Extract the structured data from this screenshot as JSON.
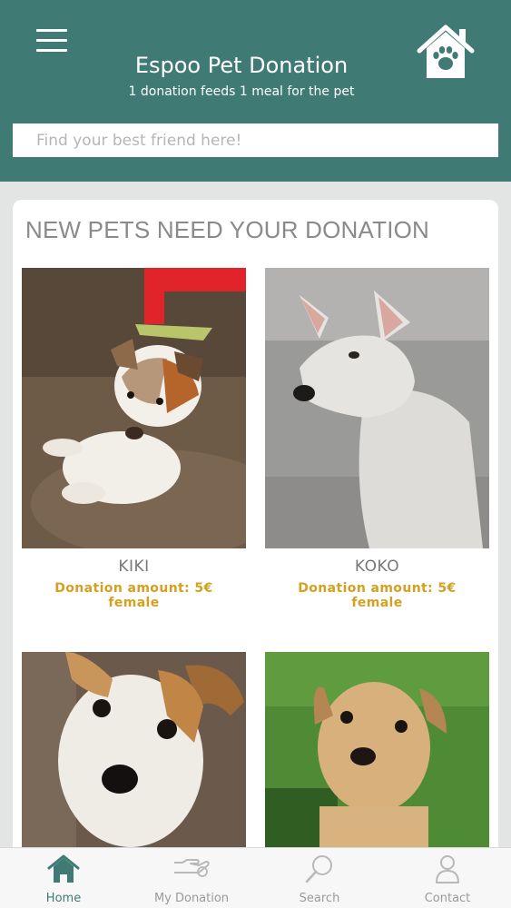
{
  "header": {
    "title": "Espoo Pet Donation",
    "subtitle": "1 donation feeds 1 meal for the pet",
    "menu_icon": "hamburger-menu-icon",
    "logo_icon": "house-paw-icon"
  },
  "search": {
    "placeholder": "Find your best friend here!",
    "value": ""
  },
  "section": {
    "title": "NEW PETS NEED YOUR DONATION"
  },
  "pets": [
    {
      "name": "KIKI",
      "amount": "Donation amount: 5€",
      "gender": "female"
    },
    {
      "name": "KOKO",
      "amount": "Donation amount: 5€",
      "gender": "female"
    },
    {
      "name": "",
      "amount": "",
      "gender": ""
    },
    {
      "name": "",
      "amount": "",
      "gender": ""
    }
  ],
  "nav": {
    "items": [
      {
        "label": "Home",
        "icon": "home-icon",
        "active": true
      },
      {
        "label": "My Donation",
        "icon": "donation-hand-icon",
        "active": false
      },
      {
        "label": "Search",
        "icon": "search-icon",
        "active": false
      },
      {
        "label": "Contact",
        "icon": "person-icon",
        "active": false
      }
    ]
  },
  "colors": {
    "primary": "#3f7a75",
    "accent": "#d4a020",
    "background": "#e3e5e4"
  }
}
